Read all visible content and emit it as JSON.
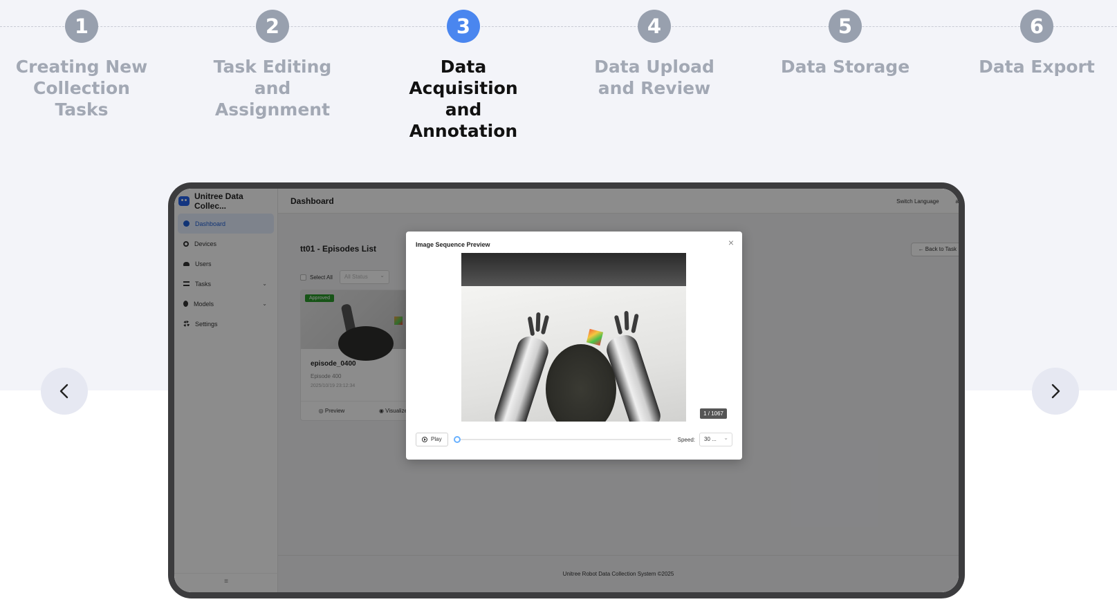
{
  "steps": [
    {
      "number": "1",
      "label": "Creating New Collection Tasks",
      "active": false
    },
    {
      "number": "2",
      "label": "Task Editing and Assignment",
      "active": false
    },
    {
      "number": "3",
      "label": "Data Acquisition and Annotation",
      "active": true
    },
    {
      "number": "4",
      "label": "Data Upload and Review",
      "active": false
    },
    {
      "number": "5",
      "label": "Data Storage",
      "active": false
    },
    {
      "number": "6",
      "label": "Data Export",
      "active": false
    }
  ],
  "carousel": {
    "prev_icon": "chevron-left-icon",
    "next_icon": "chevron-right-icon"
  },
  "app": {
    "brand": "Unitree Data Collec...",
    "header_title": "Dashboard",
    "switch_language": "Switch Language",
    "account_partial": "ac",
    "sidebar": [
      {
        "label": "Dashboard",
        "icon": "dashboard-icon"
      },
      {
        "label": "Devices",
        "icon": "devices-icon"
      },
      {
        "label": "Users",
        "icon": "users-icon"
      },
      {
        "label": "Tasks",
        "icon": "tasks-icon"
      },
      {
        "label": "Models",
        "icon": "models-icon"
      },
      {
        "label": "Settings",
        "icon": "settings-icon"
      }
    ],
    "collapse_icon": "≡",
    "page_title": "tt01 - Episodes List",
    "back_button": "← Back to Task",
    "select_all": "Select All",
    "status_placeholder": "All Status",
    "episode": {
      "badge": "Approved",
      "name": "episode_0400",
      "subtitle": "Episode 400",
      "date": "2025/10/19 23:12:34",
      "preview": "Preview",
      "visualize": "Visualize"
    },
    "footer": "Unitree Robot Data Collection System ©2025"
  },
  "modal": {
    "title": "Image Sequence Preview",
    "close": "×",
    "frame_counter": "1 / 1067",
    "play": "Play",
    "progress": 0,
    "speed_label": "Speed:",
    "speed_value": "30 ..."
  }
}
